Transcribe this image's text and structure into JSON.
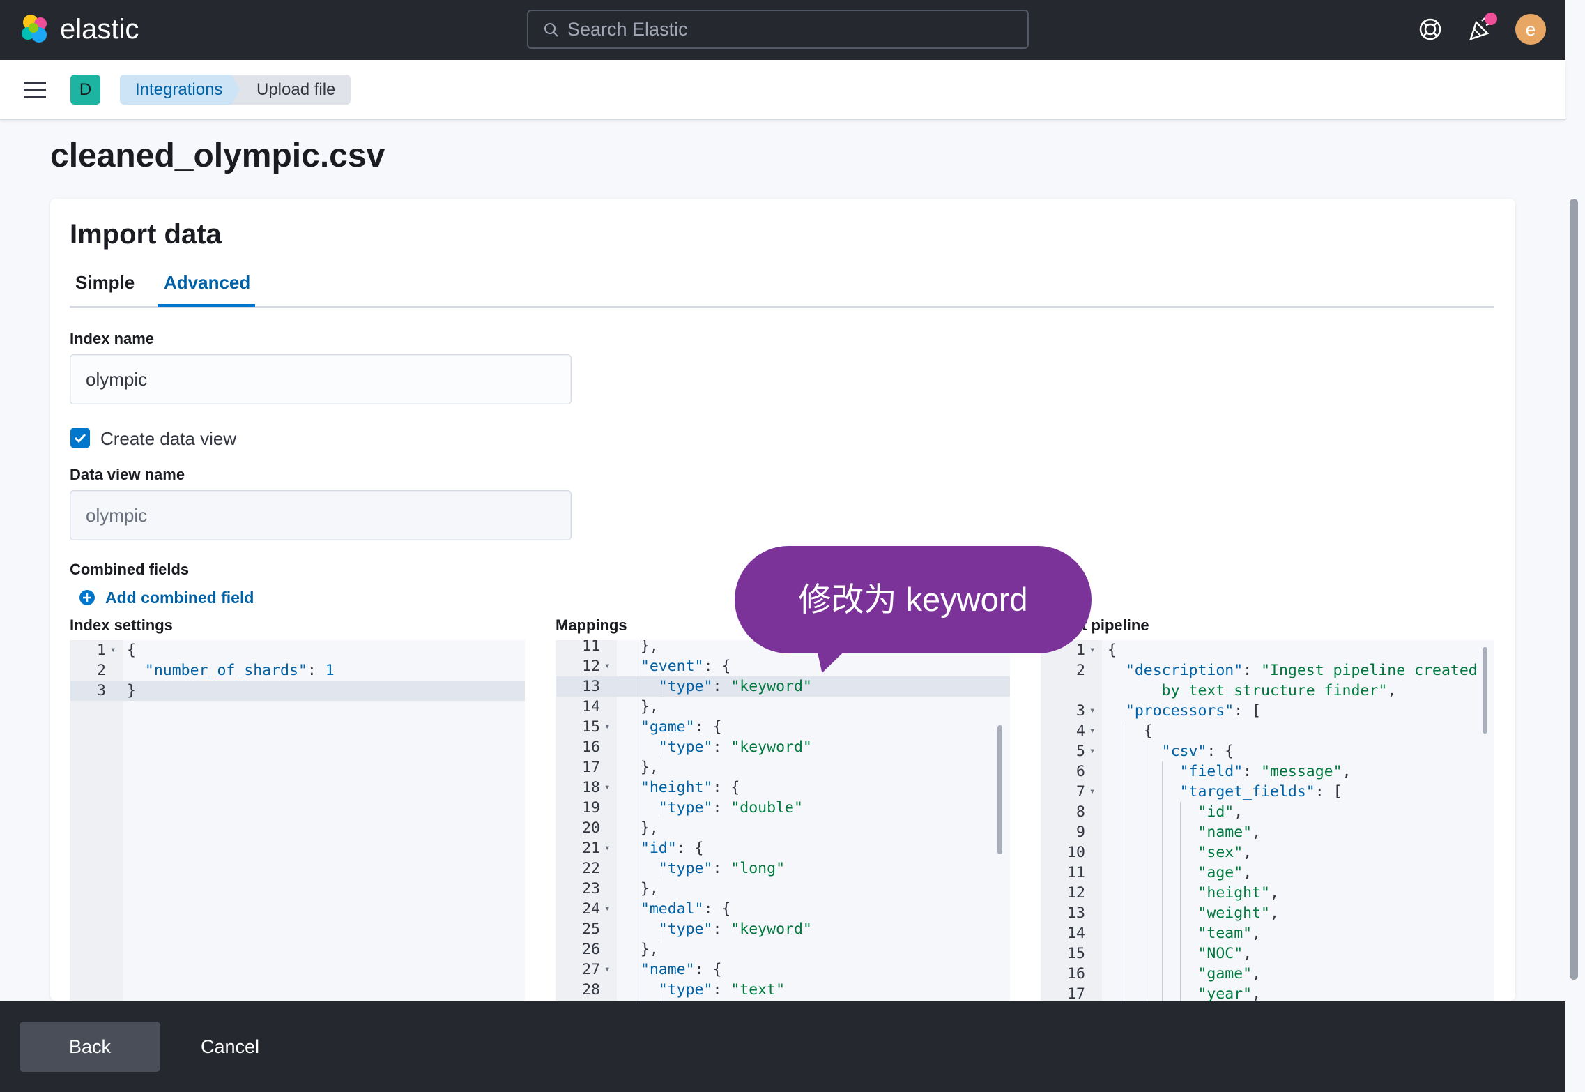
{
  "header": {
    "logo_text": "elastic",
    "search_placeholder": "Search Elastic",
    "avatar_letter": "e"
  },
  "breadcrumb": {
    "space_letter": "D",
    "items": [
      "Integrations",
      "Upload file"
    ]
  },
  "page": {
    "title": "cleaned_olympic.csv"
  },
  "import": {
    "title": "Import data",
    "tabs": [
      {
        "label": "Simple",
        "active": false
      },
      {
        "label": "Advanced",
        "active": true
      }
    ],
    "index_name_label": "Index name",
    "index_name_value": "olympic",
    "create_data_view_label": "Create data view",
    "create_data_view_checked": true,
    "data_view_name_label": "Data view name",
    "data_view_name_value": "olympic",
    "combined_fields_label": "Combined fields",
    "add_combined_field": "Add combined field",
    "index_settings_label": "Index settings",
    "mappings_label": "Mappings",
    "pipeline_label": "t pipeline"
  },
  "index_settings_lines": [
    {
      "n": "1",
      "fold": true,
      "code": "{"
    },
    {
      "n": "2",
      "fold": false,
      "code": "  \"number_of_shards\": 1"
    },
    {
      "n": "3",
      "fold": false,
      "code": "}"
    }
  ],
  "mappings_lines": [
    {
      "n": "11",
      "fold": false,
      "code": "  },"
    },
    {
      "n": "12",
      "fold": true,
      "code": "  \"event\": {"
    },
    {
      "n": "13",
      "fold": false,
      "code": "    \"type\": \"keyword\""
    },
    {
      "n": "14",
      "fold": false,
      "code": "  },"
    },
    {
      "n": "15",
      "fold": true,
      "code": "  \"game\": {"
    },
    {
      "n": "16",
      "fold": false,
      "code": "    \"type\": \"keyword\""
    },
    {
      "n": "17",
      "fold": false,
      "code": "  },"
    },
    {
      "n": "18",
      "fold": true,
      "code": "  \"height\": {"
    },
    {
      "n": "19",
      "fold": false,
      "code": "    \"type\": \"double\""
    },
    {
      "n": "20",
      "fold": false,
      "code": "  },"
    },
    {
      "n": "21",
      "fold": true,
      "code": "  \"id\": {"
    },
    {
      "n": "22",
      "fold": false,
      "code": "    \"type\": \"long\""
    },
    {
      "n": "23",
      "fold": false,
      "code": "  },"
    },
    {
      "n": "24",
      "fold": true,
      "code": "  \"medal\": {"
    },
    {
      "n": "25",
      "fold": false,
      "code": "    \"type\": \"keyword\""
    },
    {
      "n": "26",
      "fold": false,
      "code": "  },"
    },
    {
      "n": "27",
      "fold": true,
      "code": "  \"name\": {"
    },
    {
      "n": "28",
      "fold": false,
      "code": "    \"type\": \"text\""
    }
  ],
  "pipeline_lines": [
    {
      "n": "1",
      "fold": true,
      "code": "{"
    },
    {
      "n": "2",
      "fold": false,
      "code": "  \"description\": \"Ingest pipeline created"
    },
    {
      "n": "",
      "fold": false,
      "code": "      by text structure finder\","
    },
    {
      "n": "3",
      "fold": true,
      "code": "  \"processors\": ["
    },
    {
      "n": "4",
      "fold": true,
      "code": "    {"
    },
    {
      "n": "5",
      "fold": true,
      "code": "      \"csv\": {"
    },
    {
      "n": "6",
      "fold": false,
      "code": "        \"field\": \"message\","
    },
    {
      "n": "7",
      "fold": true,
      "code": "        \"target_fields\": ["
    },
    {
      "n": "8",
      "fold": false,
      "code": "          \"id\","
    },
    {
      "n": "9",
      "fold": false,
      "code": "          \"name\","
    },
    {
      "n": "10",
      "fold": false,
      "code": "          \"sex\","
    },
    {
      "n": "11",
      "fold": false,
      "code": "          \"age\","
    },
    {
      "n": "12",
      "fold": false,
      "code": "          \"height\","
    },
    {
      "n": "13",
      "fold": false,
      "code": "          \"weight\","
    },
    {
      "n": "14",
      "fold": false,
      "code": "          \"team\","
    },
    {
      "n": "15",
      "fold": false,
      "code": "          \"NOC\","
    },
    {
      "n": "16",
      "fold": false,
      "code": "          \"game\","
    },
    {
      "n": "17",
      "fold": false,
      "code": "          \"year\","
    }
  ],
  "callout": {
    "text": "修改为 keyword"
  },
  "footer": {
    "back": "Back",
    "cancel": "Cancel"
  },
  "colors": {
    "header_bg": "#25282f",
    "accent": "#0077cc",
    "callout_bg": "#7b339a"
  }
}
